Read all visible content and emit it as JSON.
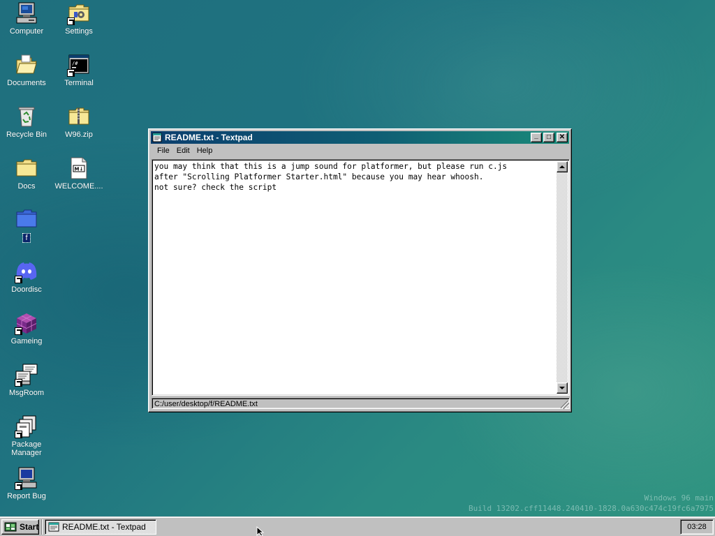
{
  "desktop": {
    "icons": [
      {
        "label": "Computer",
        "icon": "computer-icon"
      },
      {
        "label": "Settings",
        "icon": "settings-folder-icon"
      },
      {
        "label": "Documents",
        "icon": "open-folder-icon"
      },
      {
        "label": "Terminal",
        "icon": "terminal-icon"
      },
      {
        "label": "Recycle Bin",
        "icon": "recycle-bin-icon"
      },
      {
        "label": "W96.zip",
        "icon": "zip-folder-icon"
      },
      {
        "label": "Docs",
        "icon": "folder-icon"
      },
      {
        "label": "WELCOME....",
        "icon": "markdown-file-icon"
      },
      {
        "label": "f",
        "icon": "blue-folder-icon"
      },
      {
        "label": "Doordisc",
        "icon": "discord-icon"
      },
      {
        "label": "Gameing",
        "icon": "cube-icon"
      },
      {
        "label": "MsgRoom",
        "icon": "chat-icon"
      },
      {
        "label": "Package Manager",
        "icon": "package-icon"
      },
      {
        "label": "Report Bug",
        "icon": "bug-report-monitor-icon"
      }
    ],
    "watermark": {
      "line1": "Windows 96 main",
      "line2": "Build 13202.cff11448.240410-1828.0a630c474c19fc6a7975"
    }
  },
  "window": {
    "title": "README.txt - Textpad",
    "menu": [
      "File",
      "Edit",
      "Help"
    ],
    "content": "you may think that this is a jump sound for platformer, but please run c.js\nafter \"Scrolling Platformer Starter.html\" because you may hear whoosh.\nnot sure? check the script",
    "status_path": "C:/user/desktop/f/README.txt",
    "controls": {
      "minimize": "_",
      "maximize": "□",
      "close": "✕"
    }
  },
  "taskbar": {
    "start_label": "Start",
    "task_label": "README.txt - Textpad",
    "clock": "03:28"
  },
  "colors": {
    "title_start": "#0b3e6e",
    "title_end": "#1b8b7a",
    "desktop": "#1f7380",
    "chrome": "#c0c0c0"
  }
}
